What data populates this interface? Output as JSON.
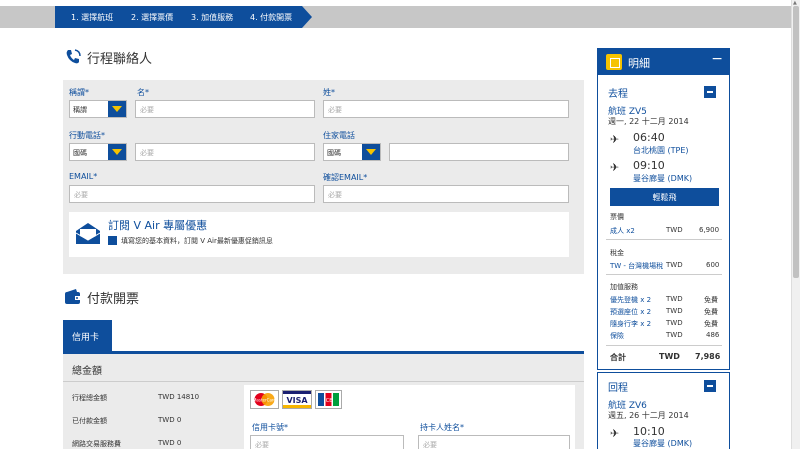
{
  "steps": [
    "1. 選擇航班",
    "2. 選擇票價",
    "3. 加值服務",
    "4. 付款開票"
  ],
  "contact": {
    "title": "行程聯絡人",
    "salutation_label": "稱謂*",
    "salutation_value": "稱謂",
    "first_name_label": "名*",
    "first_name_placeholder": "必要",
    "last_name_label": "姓*",
    "last_name_placeholder": "必要",
    "mobile_label": "行動電話*",
    "mobile_country": "國碼",
    "mobile_placeholder": "必要",
    "home_label": "住家電話",
    "home_country": "國碼",
    "email_label": "EMAIL*",
    "email_placeholder": "必要",
    "confirm_email_label": "確認EMAIL*",
    "confirm_email_placeholder": "必要",
    "subscribe_title": "訂閱 V Air 專屬優惠",
    "subscribe_text": "填寫您的基本資料，訂閱 V Air最新優惠促銷訊息"
  },
  "payment": {
    "title": "付款開票",
    "tab": "信用卡",
    "total_title": "總金額",
    "rows": [
      {
        "label": "行程總金額",
        "value": "TWD 14810"
      },
      {
        "label": "已付款金額",
        "value": "TWD 0"
      },
      {
        "label": "網路交易服務費",
        "value": "TWD 0"
      }
    ],
    "cards": [
      "MasterCard",
      "VISA",
      "JCB"
    ],
    "card_number_label": "信用卡號*",
    "card_number_placeholder": "必要",
    "holder_label": "持卡人姓名*",
    "holder_placeholder": "必要"
  },
  "summary": {
    "title": "明細",
    "outbound": {
      "heading": "去程",
      "flight": "航班 ZV5",
      "date": "週一, 22 十二月 2014",
      "dep_time": "06:40",
      "dep_airport": "台北桃園 (TPE)",
      "arr_time": "09:10",
      "arr_airport": "曼谷廊曼 (DMK)",
      "button": "輕鬆飛"
    },
    "fare_title": "票價",
    "fare_row": {
      "label": "成人 x2",
      "currency": "TWD",
      "amount": "6,900"
    },
    "tax_title": "稅金",
    "tax_row": {
      "label": "TW - 台灣機場稅",
      "currency": "TWD",
      "amount": "600"
    },
    "addon_title": "加值服務",
    "addons": [
      {
        "label": "優先登機 x 2",
        "currency": "TWD",
        "amount": "免費"
      },
      {
        "label": "預選座位 x 2",
        "currency": "TWD",
        "amount": "免費"
      },
      {
        "label": "隨身行李 x 2",
        "currency": "TWD",
        "amount": "免費"
      },
      {
        "label": "保險",
        "currency": "TWD",
        "amount": "486"
      }
    ],
    "total_label": "合計",
    "total_currency": "TWD",
    "total_amount": "7,986",
    "return": {
      "heading": "回程",
      "flight": "航班 ZV6",
      "date": "週五, 26 十二月 2014",
      "dep_time": "10:10",
      "dep_airport": "曼谷廊曼 (DMK)"
    }
  }
}
